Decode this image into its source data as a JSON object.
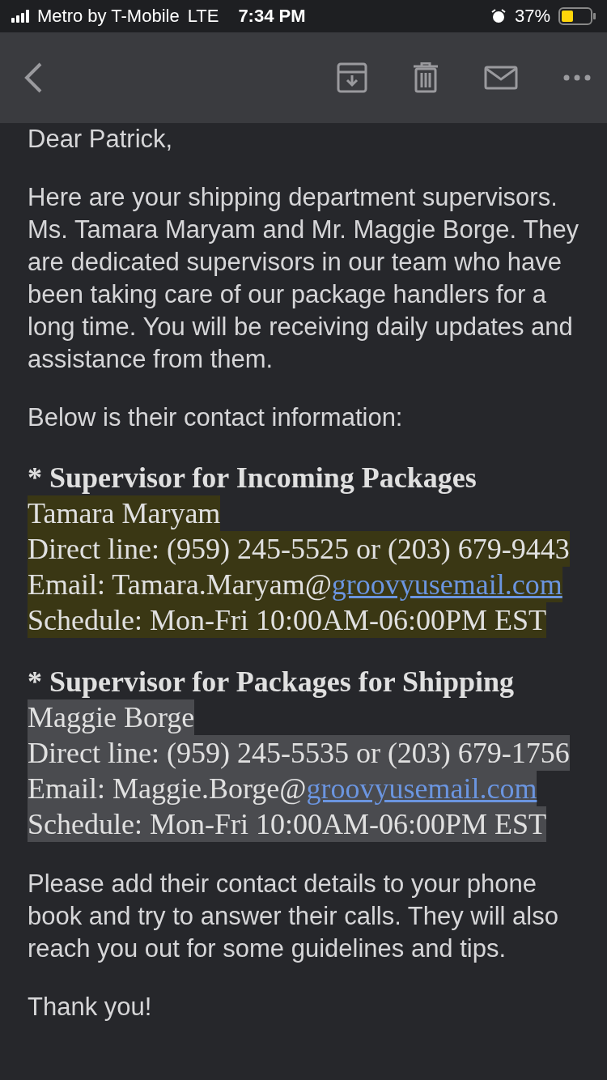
{
  "status_bar": {
    "carrier": "Metro by T-Mobile",
    "network": "LTE",
    "time": "7:34 PM",
    "battery": "37%"
  },
  "greeting": "Dear Patrick,",
  "intro": [
    "Here are your shipping department supervisors. Ms. Tamara Maryam and Mr. Maggie Borge. They are dedicated supervisors in our team who have been taking care of our package handlers for a long time. You will be receiving daily updates and assistance from them.",
    "Below is their contact information:"
  ],
  "contacts": [
    {
      "heading": "* Supervisor for Incoming Packages",
      "color": "#3a3714",
      "lines": [
        {
          "text": "Tamara Maryam"
        },
        {
          "text": "Direct line: (959) 245-5525 or (203) 679-9443"
        },
        {
          "text": "Email: Tamara.Maryam@",
          "link": "groovyusemail.com"
        },
        {
          "text": "Schedule: Mon-Fri 10:00AM-06:00PM EST"
        }
      ]
    },
    {
      "heading": "* Supervisor for Packages for Shipping",
      "color": "#4a4b4f",
      "lines": [
        {
          "text": "Maggie Borge"
        },
        {
          "text": "Direct line: (959) 245-5535 or (203) 679-1756"
        },
        {
          "text": "Email: Maggie.Borge@",
          "link": "groovyusemail.com"
        },
        {
          "text": "Schedule: Mon-Fri 10:00AM-06:00PM EST"
        }
      ]
    }
  ],
  "outro": [
    "Please add their contact details to your phone book and try to answer their calls. They will also reach you out for some guidelines and tips.",
    "Thank you!"
  ]
}
